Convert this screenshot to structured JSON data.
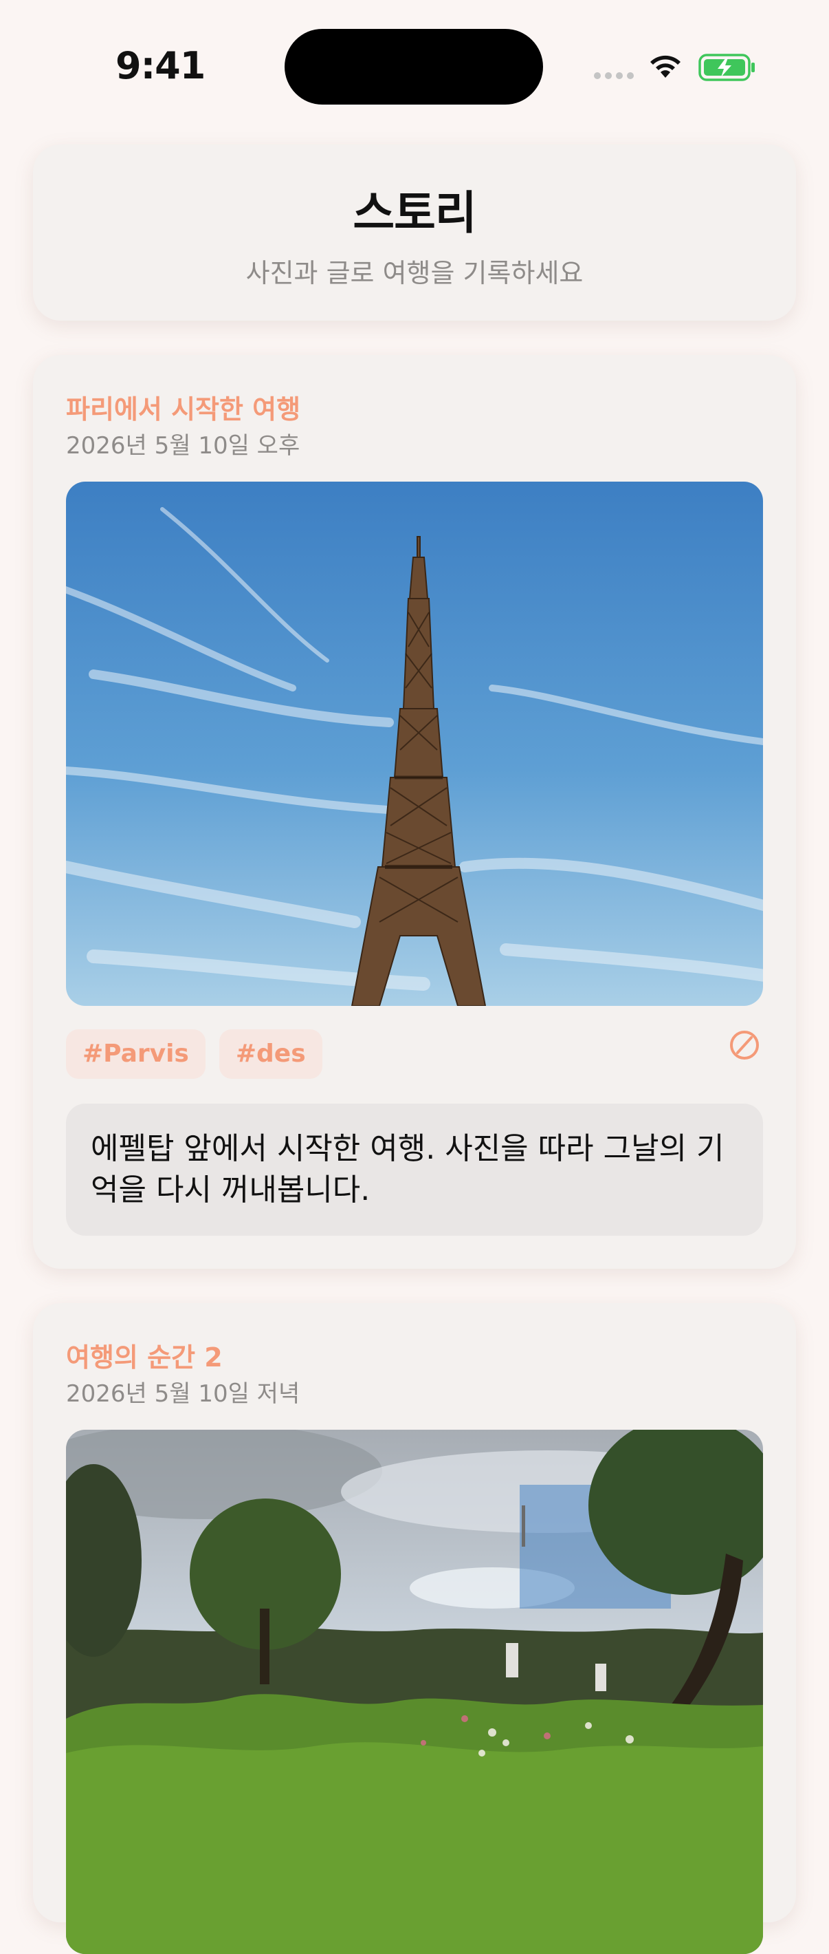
{
  "status_bar": {
    "time": "9:41"
  },
  "header": {
    "title": "스토리",
    "subtitle": "사진과 글로 여행을 기록하세요"
  },
  "stories": [
    {
      "title": "파리에서 시작한 여행",
      "date": "2026년 5월 10일 오후",
      "photo": "eiffel-tower-photo",
      "tags": [
        "#Parvis",
        "#des"
      ],
      "text": "에펠탑 앞에서 시작한 여행. 사진을 따라 그날의 기억을 다시 꺼내봅니다."
    },
    {
      "title": "여행의 순간 2",
      "date": "2026년 5월 10일 저녁",
      "photo": "garden-photo"
    }
  ],
  "icons": {
    "wifi": "wifi-icon",
    "battery": "battery-charging-icon",
    "ban": "ban-icon"
  },
  "colors": {
    "background": "#fbf5f3",
    "card": "#f4f1ef",
    "accent": "#f49a78",
    "tag_background": "#f7e7e2",
    "muted_text": "#8e8b89"
  }
}
